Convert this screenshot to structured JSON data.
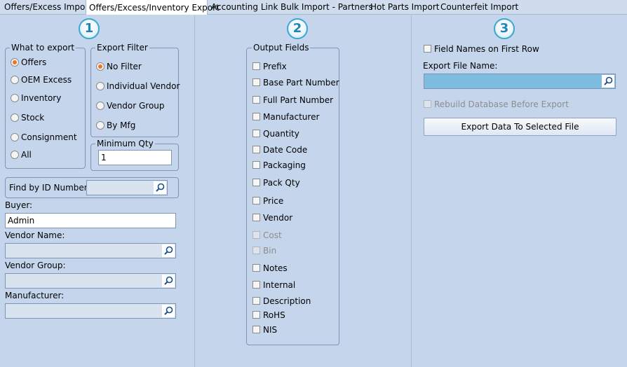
{
  "tabs": [
    {
      "label": "Offers/Excess Import",
      "active": false
    },
    {
      "label": "Offers/Excess/Inventory Export",
      "active": true
    },
    {
      "label": "Accounting Link",
      "active": false
    },
    {
      "label": "Bulk Import - Partners",
      "active": false
    },
    {
      "label": "Hot Parts Import",
      "active": false
    },
    {
      "label": "Counterfeit Import",
      "active": false
    }
  ],
  "steps": [
    "1",
    "2",
    "3"
  ],
  "what_to_export": {
    "title": "What to export",
    "options": [
      "Offers",
      "OEM Excess",
      "Inventory",
      "Stock",
      "Consignment",
      "All"
    ],
    "selected": "Offers"
  },
  "export_filter": {
    "title": "Export Filter",
    "options": [
      "No Filter",
      "Individual Vendor",
      "Vendor Group",
      "By Mfg"
    ],
    "selected": "No Filter"
  },
  "minimum_qty": {
    "title": "Minimum Qty",
    "value": "1"
  },
  "find_by_id": {
    "label": "Find by ID Number:",
    "value": ""
  },
  "buyer": {
    "label": "Buyer:",
    "value": "Admin"
  },
  "vendor_name": {
    "label": "Vendor Name:",
    "value": ""
  },
  "vendor_group": {
    "label": "Vendor Group:",
    "value": ""
  },
  "manufacturer": {
    "label": "Manufacturer:",
    "value": ""
  },
  "output_fields": {
    "title": "Output Fields",
    "fields": [
      {
        "label": "Prefix",
        "enabled": true
      },
      {
        "label": "Base Part Number",
        "enabled": true
      },
      {
        "label": "Full Part Number",
        "enabled": true
      },
      {
        "label": "Manufacturer",
        "enabled": true
      },
      {
        "label": "Quantity",
        "enabled": true
      },
      {
        "label": "Date Code",
        "enabled": true
      },
      {
        "label": "Packaging",
        "enabled": true
      },
      {
        "label": "Pack Qty",
        "enabled": true
      },
      {
        "label": "Price",
        "enabled": true
      },
      {
        "label": "Vendor",
        "enabled": true
      },
      {
        "label": "Cost",
        "enabled": false
      },
      {
        "label": "Bin",
        "enabled": false
      },
      {
        "label": "Notes",
        "enabled": true
      },
      {
        "label": "Internal",
        "enabled": true
      },
      {
        "label": "Description",
        "enabled": true
      },
      {
        "label": "RoHS",
        "enabled": true
      },
      {
        "label": "NIS",
        "enabled": true
      }
    ]
  },
  "export_settings": {
    "field_names_label": "Field Names on First Row",
    "export_file_label": "Export File Name:",
    "export_file_value": "",
    "rebuild_label": "Rebuild Database Before Export",
    "export_button_label": "Export Data To Selected File"
  },
  "colors": {
    "background": "#c5d6ec",
    "step_accent": "#3aa7cf",
    "radio_selected": "#e8771f",
    "file_field": "#7fbde0"
  }
}
